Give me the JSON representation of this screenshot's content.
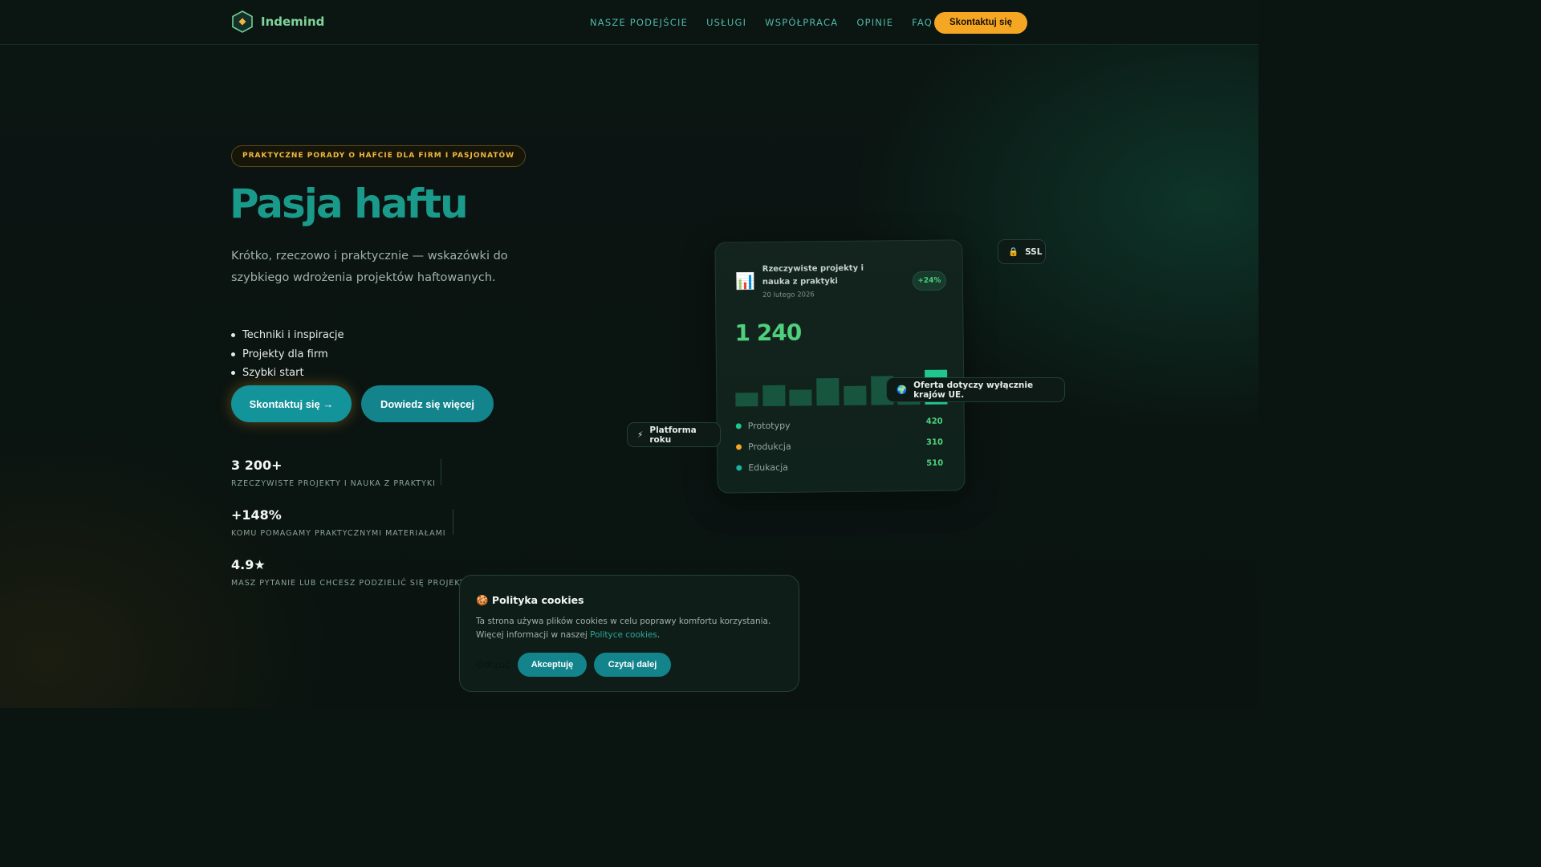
{
  "header": {
    "brand": "Indemind",
    "nav": [
      "NASZE PODEJŚCIE",
      "USŁUGI",
      "WSPÓŁPRACA",
      "OPINIE",
      "FAQ"
    ],
    "cta": "Skontaktuj się"
  },
  "hero": {
    "badge": "PRAKTYCZNE PORADY O HAFCIE DLA FIRM I PASJONATÓW",
    "title": "Pasja haftu",
    "subtitle": "Krótko, rzeczowo i praktycznie — wskazówki do szybkiego wdrożenia projektów haftowanych.",
    "bullets": [
      "Techniki i inspiracje",
      "Projekty dla firm",
      "Szybki start"
    ],
    "primary_button": "Skontaktuj się →",
    "secondary_button": "Dowiedz się więcej"
  },
  "stats": [
    {
      "value": "3 200+",
      "label": "RZECZYWISTE PROJEKTY I NAUKA Z PRAKTYKI"
    },
    {
      "value": "+148%",
      "label": "KOMU POMAGAMY PRAKTYCZNYMI MATERIAŁAMI"
    },
    {
      "value": "4.9★",
      "label": "MASZ PYTANIE LUB CHCESZ PODZIELIĆ SIĘ PROJEKTEM?"
    }
  ],
  "card": {
    "icon": "bar-chart-icon",
    "title": "Rzeczywiste projekty i nauka z praktyki",
    "date": "20 lutego 2026",
    "change": "+24%",
    "big_value": "1 240",
    "bars": [
      0.35,
      0.55,
      0.42,
      0.7,
      0.5,
      0.75,
      0.6,
      0.9
    ],
    "legend": [
      {
        "name": "Prototypy",
        "value": "420",
        "color": "#1fc78e"
      },
      {
        "name": "Produkcja",
        "value": "310",
        "color": "#f5a623"
      },
      {
        "name": "Edukacja",
        "value": "510",
        "color": "#1ab3a6"
      }
    ]
  },
  "chips": {
    "ssl": "SSL",
    "eu": "Oferta dotyczy wyłącznie krajów UE.",
    "platform": "Platforma roku"
  },
  "cookies": {
    "title": "🍪 Polityka cookies",
    "text": "Ta strona używa plików cookies w celu poprawy komfortu korzystania. Więcej informacji w naszej ",
    "link": "Polityce cookies",
    "text_end": ".",
    "reject": "Odrzuć",
    "accept": "Akceptuję",
    "more": "Czytaj dalej"
  },
  "colors": {
    "accent": "#f5a623",
    "teal": "#13848c",
    "green": "#4ed07c"
  }
}
